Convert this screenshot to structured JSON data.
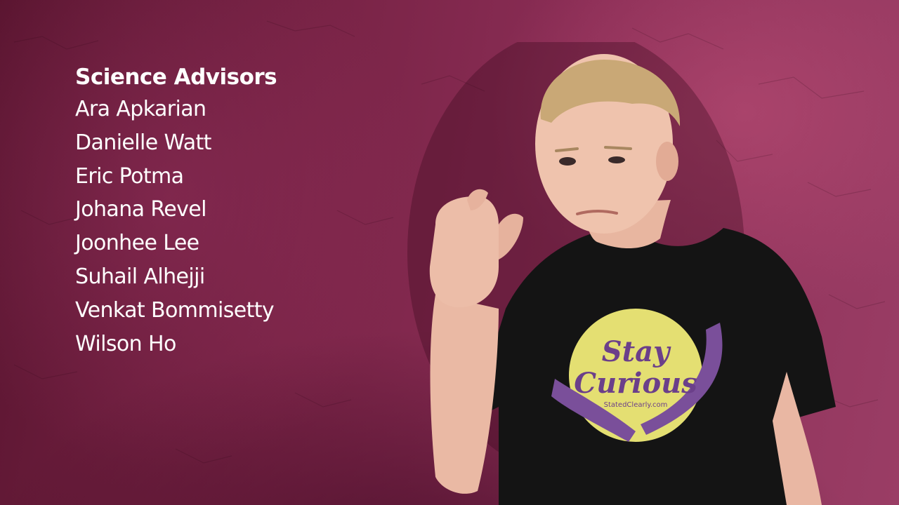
{
  "credits": {
    "title": "Science Advisors",
    "names": [
      "Ara Apkarian",
      "Danielle Watt",
      "Eric Potma",
      "Johana Revel",
      "Joonhee Lee",
      "Suhail Alhejji",
      "Venkat Bommisetty",
      "Wilson Ho"
    ]
  },
  "shirt": {
    "line1": "Stay",
    "line2": "Curious",
    "site": "StatedClearly.com"
  },
  "colors": {
    "wall": "#7a2447",
    "shirt": "#111111",
    "logo_circle": "#e4df72",
    "logo_purple": "#7a4f9a",
    "text": "#ffffff"
  }
}
